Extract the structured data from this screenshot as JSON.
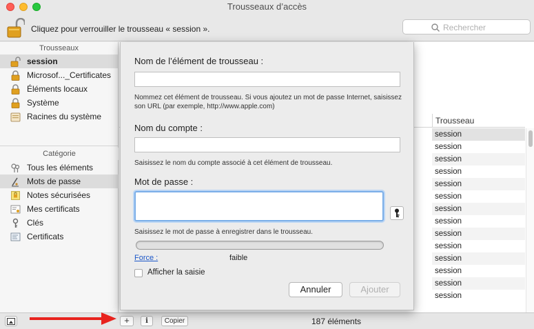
{
  "window": {
    "title": "Trousseaux d’accès"
  },
  "toolbar": {
    "lock_message": "Cliquez pour verrouiller le trousseau « session ».",
    "search_placeholder": "Rechercher"
  },
  "sidebar": {
    "keychains_header": "Trousseaux",
    "keychains": [
      {
        "label": "session",
        "icon": "unlocked-padlock-icon",
        "selected": true
      },
      {
        "label": "Microsof..._Certificates",
        "icon": "padlock-icon"
      },
      {
        "label": "Éléments locaux",
        "icon": "padlock-icon"
      },
      {
        "label": "Système",
        "icon": "padlock-icon"
      },
      {
        "label": "Racines du système",
        "icon": "certificate-cabinet-icon"
      }
    ],
    "category_header": "Catégorie",
    "categories": [
      {
        "label": "Tous les éléments",
        "icon": "all-items-icon"
      },
      {
        "label": "Mots de passe",
        "icon": "password-pen-icon",
        "selected": true
      },
      {
        "label": "Notes sécurisées",
        "icon": "secure-note-icon"
      },
      {
        "label": "Mes certificats",
        "icon": "my-certificate-icon"
      },
      {
        "label": "Clés",
        "icon": "key-icon"
      },
      {
        "label": "Certificats",
        "icon": "certificate-icon"
      }
    ]
  },
  "list": {
    "column_header": "Trousseau",
    "rows": [
      "session",
      "session",
      "session",
      "session",
      "session",
      "session",
      "session",
      "session",
      "session",
      "session",
      "session",
      "session",
      "session",
      "session"
    ]
  },
  "bottombar": {
    "copy_label": "Copier",
    "add_label": "+",
    "info_label": "i",
    "item_count": "187 éléments"
  },
  "dialog": {
    "item_name_label": "Nom de l’élément de trousseau :",
    "item_name_value": "",
    "item_name_help": "Nommez cet élément de trousseau. Si vous ajoutez un mot de passe Internet, saisissez son URL (par exemple, http://www.apple.com)",
    "account_label": "Nom du compte :",
    "account_value": "",
    "account_help": "Saisissez le nom du compte associé à cet élément de trousseau.",
    "password_label": "Mot de passe :",
    "password_value": "",
    "password_help": "Saisissez le mot de passe à enregistrer dans le trousseau.",
    "strength_fraction": 0,
    "force_label": "Force :",
    "force_value": "faible",
    "show_typing_label": "Afficher la saisie",
    "show_typing_checked": false,
    "cancel_label": "Annuler",
    "add_label": "Ajouter"
  },
  "colors": {
    "focus_ring": "#7aaee8",
    "link": "#1a56c8",
    "annotation_arrow": "#e8231e"
  }
}
